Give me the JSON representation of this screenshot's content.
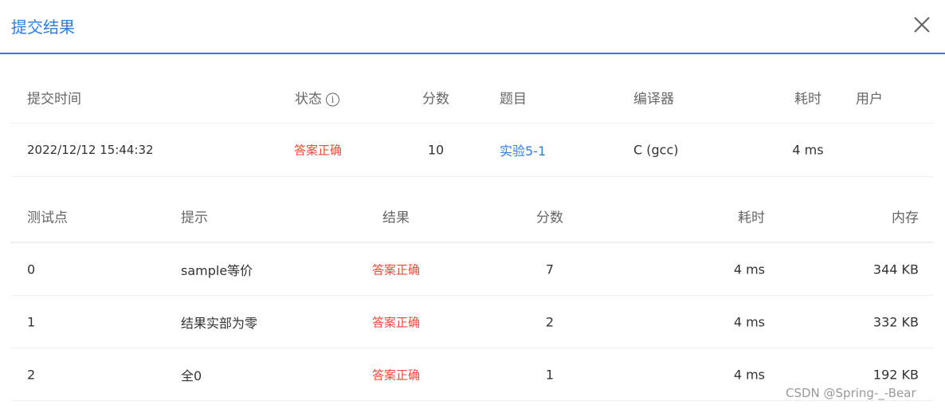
{
  "dialog": {
    "title": "提交结果",
    "close_icon": "close-icon"
  },
  "submission": {
    "headers": {
      "time": "提交时间",
      "status": "状态",
      "score": "分数",
      "problem": "题目",
      "compiler": "编译器",
      "duration": "耗时",
      "user": "用户"
    },
    "info_icon": "info-icon",
    "row": {
      "time": "2022/12/12 15:44:32",
      "status": "答案正确",
      "score": "10",
      "problem": "实验5-1",
      "compiler": "C (gcc)",
      "duration": "4 ms",
      "user": ""
    }
  },
  "testcases": {
    "headers": {
      "id": "测试点",
      "hint": "提示",
      "result": "结果",
      "score": "分数",
      "duration": "耗时",
      "memory": "内存"
    },
    "rows": [
      {
        "id": "0",
        "hint": "sample等价",
        "result": "答案正确",
        "score": "7",
        "duration": "4 ms",
        "memory": "344 KB"
      },
      {
        "id": "1",
        "hint": "结果实部为零",
        "result": "答案正确",
        "score": "2",
        "duration": "4 ms",
        "memory": "332 KB"
      },
      {
        "id": "2",
        "hint": "全0",
        "result": "答案正确",
        "score": "1",
        "duration": "4 ms",
        "memory": "192 KB"
      }
    ]
  },
  "colors": {
    "accent": "#2b7de9",
    "success_text": "#f5483b"
  },
  "watermark": "CSDN @Spring-_-Bear"
}
